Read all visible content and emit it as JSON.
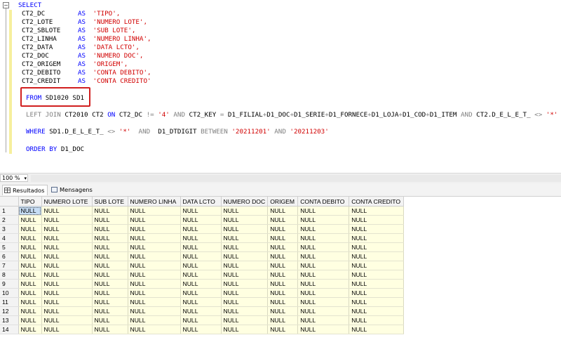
{
  "editor": {
    "select_kw": "SELECT",
    "as_kw": "AS",
    "columns": [
      {
        "field": "CT2_DC",
        "alias": "'TIPO',"
      },
      {
        "field": "CT2_LOTE",
        "alias": "'NUMERO LOTE',"
      },
      {
        "field": "CT2_SBLOTE",
        "alias": "'SUB LOTE',"
      },
      {
        "field": "CT2_LINHA",
        "alias": "'NUMERO LINHA',"
      },
      {
        "field": "CT2_DATA",
        "alias": "'DATA LCTO',"
      },
      {
        "field": "CT2_DOC",
        "alias": "'NUMERO DOC',"
      },
      {
        "field": "CT2_ORIGEM",
        "alias": "'ORIGEM',"
      },
      {
        "field": "CT2_DEBITO",
        "alias": "'CONTA DEBITO',"
      },
      {
        "field": "CT2_CREDIT",
        "alias": "'CONTA CREDITO'"
      }
    ],
    "from_kw": "FROM",
    "from_table": "SD1020 SD1",
    "join_kw": "LEFT JOIN",
    "join_table": "CT2010 CT2",
    "on_kw": "ON",
    "join_cond_a": "CT2_DC",
    "neq": "!=",
    "str_4": "'4'",
    "and_kw": "AND",
    "join_key": "CT2_KEY",
    "eq": "=",
    "concat_fields": [
      "D1_FILIAL",
      "D1_DOC",
      "D1_SERIE",
      "D1_FORNECE",
      "D1_LOJA",
      "D1_COD",
      "D1_ITEM"
    ],
    "plus": "+",
    "del_field": "CT2.D_E_L_E_T_",
    "ne": "<>",
    "str_star": "'*'",
    "where_kw": "WHERE",
    "where_field": "SD1.D_E_L_E_T_",
    "dtdigit": "D1_DTDIGIT",
    "between_kw": "BETWEEN",
    "date_from": "'20211201'",
    "date_to": "'20211203'",
    "order_kw": "ORDER BY",
    "order_field": "D1_DOC"
  },
  "zoom": {
    "value": "100 %"
  },
  "tabs": [
    {
      "label": "Resultados"
    },
    {
      "label": "Mensagens"
    }
  ],
  "grid": {
    "headers": [
      "TIPO",
      "NUMERO LOTE",
      "SUB LOTE",
      "NUMERO LINHA",
      "DATA LCTO",
      "NUMERO DOC",
      "ORIGEM",
      "CONTA DEBITO",
      "CONTA CREDITO"
    ],
    "row_numbers": [
      "1",
      "2",
      "3",
      "4",
      "5",
      "6",
      "7",
      "8",
      "9",
      "10",
      "11",
      "12",
      "13",
      "14"
    ],
    "cell_value": "NULL"
  }
}
